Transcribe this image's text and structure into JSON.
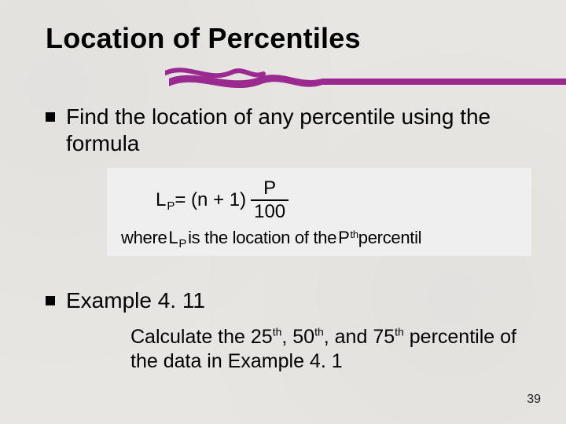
{
  "title": "Location of Percentiles",
  "bullet1": "Find the location of any percentile using the formula",
  "formula": {
    "lhs_L": "L",
    "lhs_P": "P",
    "eq": " = (n + 1)",
    "frac_num": "P",
    "frac_den": "100",
    "where_a": "where",
    "where_L": "L",
    "where_Psub": "P",
    "where_b": " is the location of the ",
    "where_Pmain": "P",
    "where_th": "th",
    "where_c": " percentil"
  },
  "bullet2": "Example 4. 11",
  "subtext_a": "Calculate the 25",
  "subtext_b": ", 50",
  "subtext_c": ", and 75",
  "subtext_d": " percentile of the data in Example 4. 1",
  "th": "th",
  "pagenum": "39",
  "swoosh_color": "#9b2a90"
}
